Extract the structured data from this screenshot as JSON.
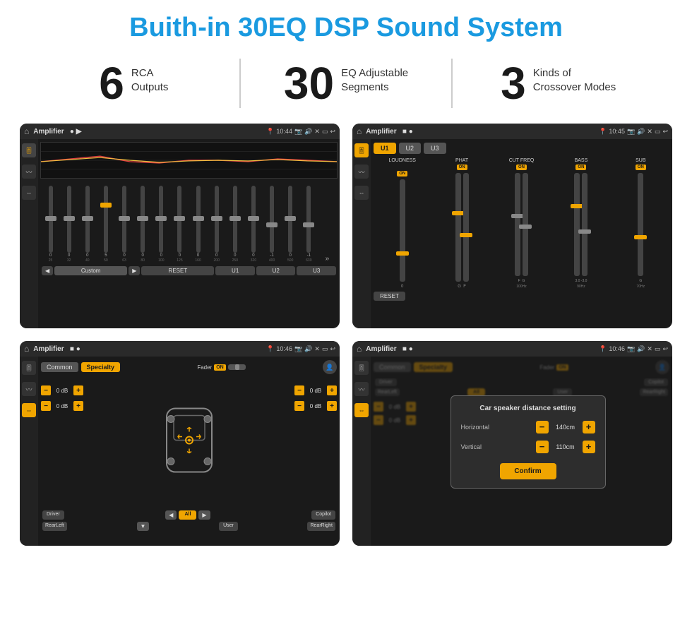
{
  "page": {
    "title": "Buith-in 30EQ DSP Sound System"
  },
  "stats": [
    {
      "number": "6",
      "label": "RCA\nOutputs"
    },
    {
      "number": "30",
      "label": "EQ Adjustable\nSegments"
    },
    {
      "number": "3",
      "label": "Kinds of\nCrossover Modes"
    }
  ],
  "screen1": {
    "statusbar": {
      "title": "Amplifier",
      "time": "10:44"
    },
    "freqs": [
      "25",
      "32",
      "40",
      "50",
      "63",
      "80",
      "100",
      "125",
      "160",
      "200",
      "250",
      "320",
      "400",
      "500",
      "630"
    ],
    "values": [
      "0",
      "0",
      "0",
      "5",
      "0",
      "0",
      "0",
      "0",
      "0",
      "0",
      "0",
      "0",
      "-1",
      "0",
      "-1"
    ],
    "thumbPositions": [
      50,
      50,
      50,
      30,
      50,
      50,
      50,
      50,
      50,
      50,
      50,
      50,
      60,
      50,
      60
    ],
    "buttons": [
      "Custom",
      "RESET",
      "U1",
      "U2",
      "U3"
    ]
  },
  "screen2": {
    "statusbar": {
      "title": "Amplifier",
      "time": "10:45"
    },
    "presets": [
      "U1",
      "U2",
      "U3"
    ],
    "cols": [
      {
        "label": "LOUDNESS",
        "on": true,
        "thumbPos": 80
      },
      {
        "label": "PHAT",
        "on": true,
        "thumbPos": 40
      },
      {
        "label": "CUT FREQ",
        "on": true,
        "thumbPos": 50
      },
      {
        "label": "BASS",
        "on": true,
        "thumbPos": 35
      },
      {
        "label": "SUB",
        "on": true,
        "thumbPos": 60
      }
    ],
    "resetBtn": "RESET"
  },
  "screen3": {
    "statusbar": {
      "title": "Amplifier",
      "time": "10:46"
    },
    "tabs": [
      "Common",
      "Specialty"
    ],
    "activeTab": "Specialty",
    "faderLabel": "Fader",
    "faderOn": "ON",
    "dbValues": [
      "0 dB",
      "0 dB",
      "0 dB",
      "0 dB"
    ],
    "bottomLabels": [
      "Driver",
      "All",
      "User",
      "RearRight",
      "Copilot",
      "RearLeft"
    ]
  },
  "screen4": {
    "statusbar": {
      "title": "Amplifier",
      "time": "10:46"
    },
    "tabs": [
      "Common",
      "Specialty"
    ],
    "dialog": {
      "title": "Car speaker distance setting",
      "rows": [
        {
          "label": "Horizontal",
          "value": "140cm"
        },
        {
          "label": "Vertical",
          "value": "110cm"
        }
      ],
      "confirmLabel": "Confirm"
    },
    "dbValues": [
      "0 dB",
      "0 dB"
    ],
    "bottomLabels": [
      "Driver",
      "RearLeft",
      "All",
      "User",
      "RearRight",
      "Copilot"
    ]
  },
  "icons": {
    "home": "⌂",
    "back": "↩",
    "location": "📍",
    "camera": "📷",
    "volume": "🔊",
    "close": "✕",
    "window": "▭",
    "eq": "🎚",
    "wave": "〰",
    "arrows": "⇔",
    "prev": "◀",
    "next": "▶",
    "expand": "»",
    "person": "👤",
    "dots": "⋯"
  }
}
